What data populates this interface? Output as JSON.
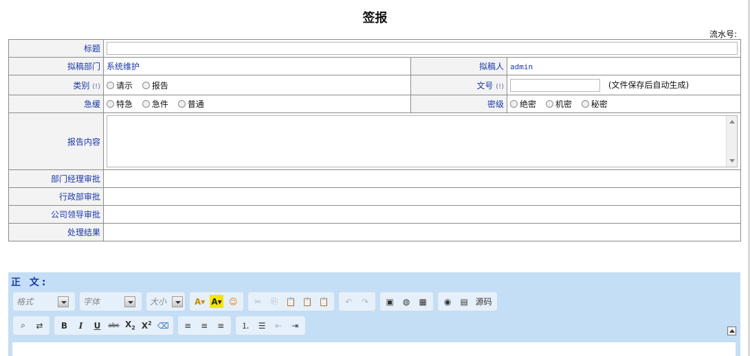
{
  "page": {
    "title": "签报",
    "serial_label": "流水号:"
  },
  "form": {
    "title_label": "标题",
    "dept_label": "拟稿部门",
    "dept_value": "系统维护",
    "drafter_label": "拟稿人",
    "drafter_value": "admin",
    "category_label": "类别",
    "category_hint": "(!)",
    "category_options": [
      "请示",
      "报告"
    ],
    "docno_label": "文号",
    "docno_hint": "(!)",
    "docno_note": "(文件保存后自动生成)",
    "urgency_label": "急缓",
    "urgency_options": [
      "特急",
      "急件",
      "普通"
    ],
    "secret_label": "密级",
    "secret_options": [
      "绝密",
      "机密",
      "秘密"
    ],
    "content_label": "报告内容",
    "approvals": [
      "部门经理审批",
      "行政部审批",
      "公司领导审批",
      "处理结果"
    ]
  },
  "editor": {
    "title": "正 文:",
    "format_placeholder": "格式",
    "font_placeholder": "字体",
    "size_placeholder": "大小",
    "source_label": "源码"
  }
}
